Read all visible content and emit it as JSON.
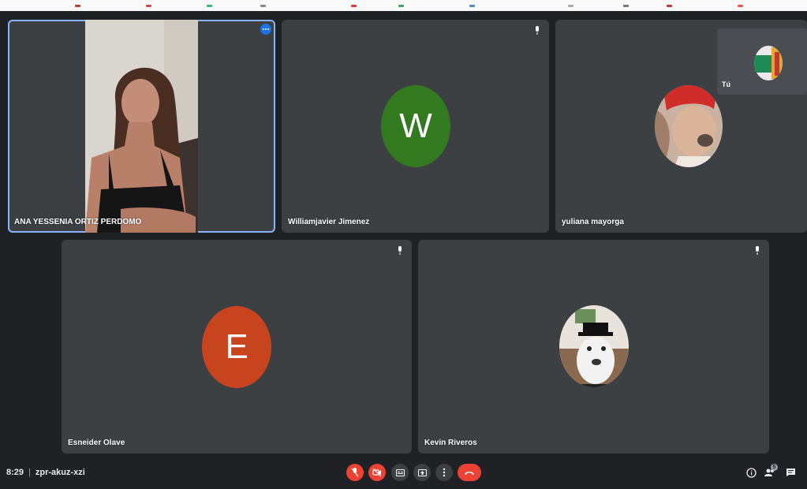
{
  "meeting": {
    "time": "8:29",
    "separator": "|",
    "code": "zpr-akuz-xzi"
  },
  "self_view": {
    "label": "Tú"
  },
  "participants": [
    {
      "name": "ANA YESSENIA ORTIZ PERDOMO",
      "type": "video",
      "active": true
    },
    {
      "name": "Williamjavier Jimenez",
      "type": "letter-avatar",
      "initial": "W",
      "avatar_color": "#33791f"
    },
    {
      "name": "yuliana mayorga",
      "type": "photo-avatar",
      "icon": "person-photo-avatar"
    },
    {
      "name": "Esneider Olave",
      "type": "letter-avatar",
      "initial": "E",
      "avatar_color": "#c7441f"
    },
    {
      "name": "Kevin Riveros",
      "type": "photo-avatar",
      "icon": "dog-photo-avatar"
    }
  ],
  "controls": {
    "mic": {
      "icon": "mic-off-icon",
      "color": "#ea4335"
    },
    "camera": {
      "icon": "camera-off-icon",
      "color": "#ea4335"
    },
    "captions": {
      "icon": "captions-icon"
    },
    "present": {
      "icon": "present-icon"
    },
    "more": {
      "icon": "more-vert-icon"
    },
    "hangup": {
      "icon": "hangup-icon",
      "color": "#ea4335"
    }
  },
  "right_controls": {
    "info": {
      "icon": "info-icon"
    },
    "people": {
      "icon": "people-icon",
      "count": "5"
    },
    "chat": {
      "icon": "chat-icon"
    }
  },
  "colors": {
    "background": "#202124",
    "tile": "#3c4043",
    "active_border": "#8ab4f8"
  }
}
